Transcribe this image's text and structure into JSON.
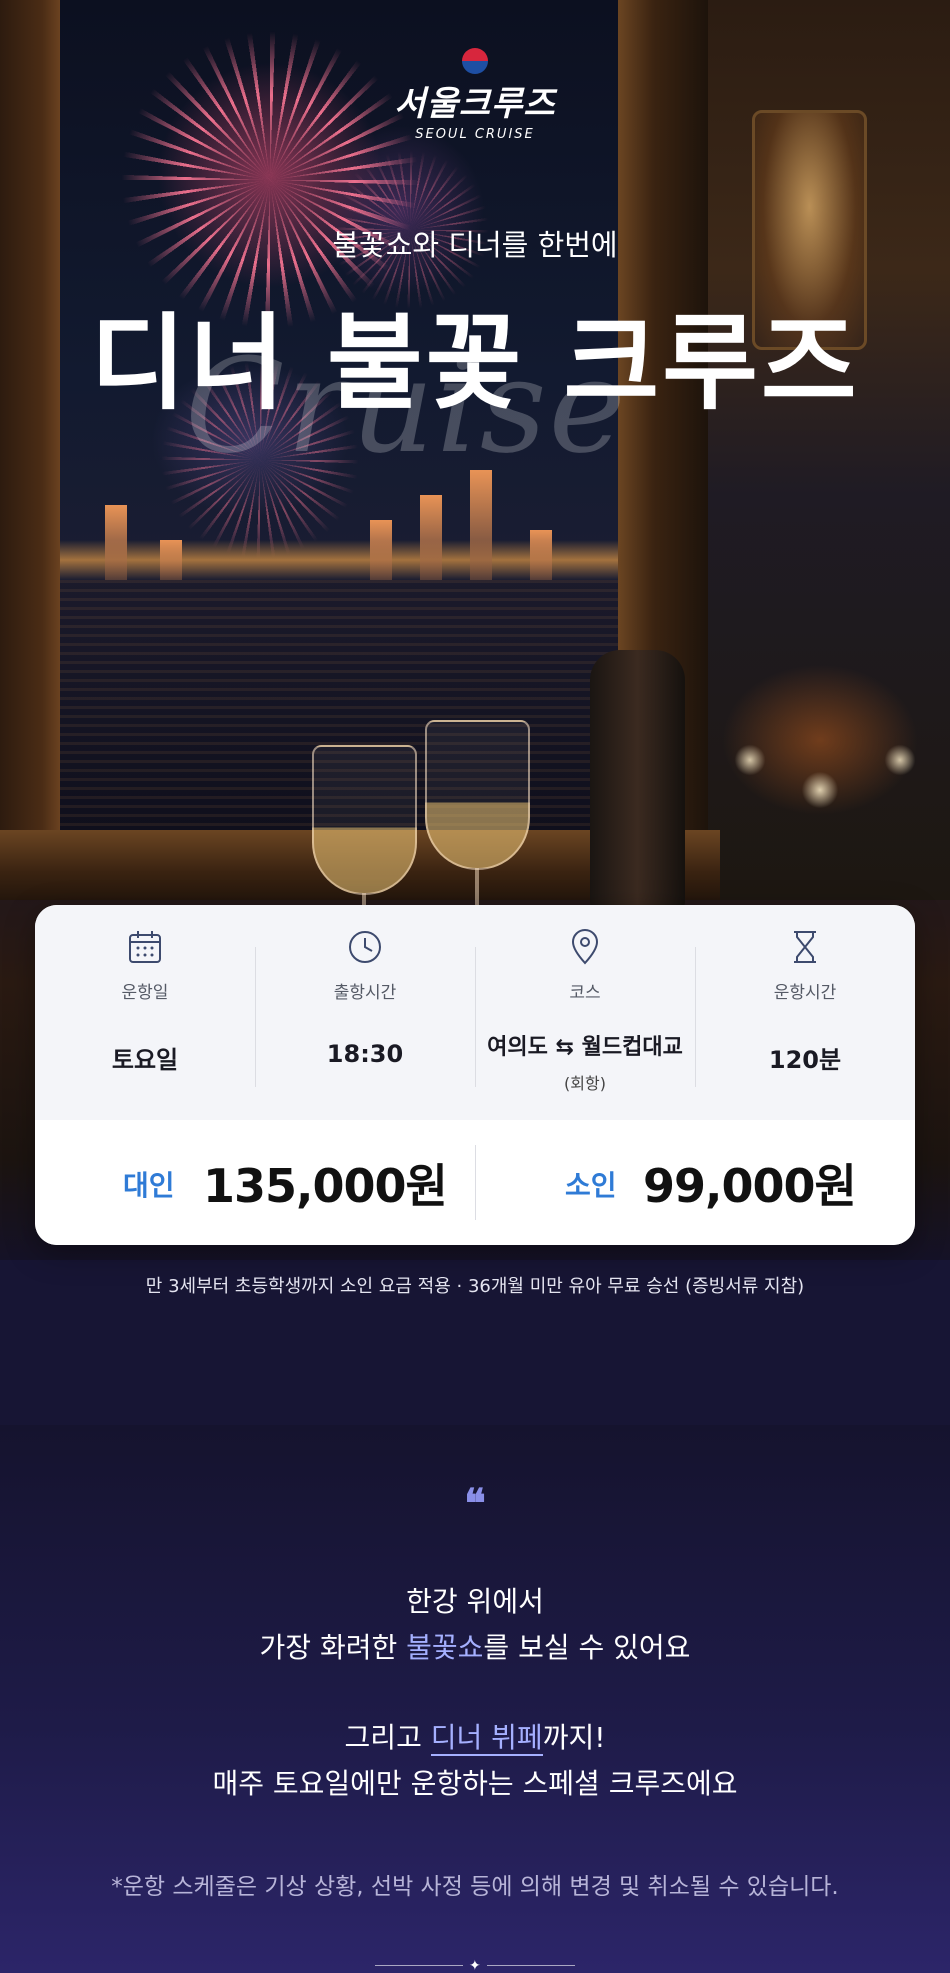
{
  "brand": {
    "name": "서울크루즈",
    "tagline": "SEOUL CRUISE"
  },
  "hero": {
    "subtitle": "불꽃쇼와 디너를 한번에",
    "title": "디너 불꽃 크루즈",
    "script_word": "Cruise"
  },
  "info": [
    {
      "icon": "calendar-icon",
      "label": "운항일",
      "value": "토요일",
      "sub": ""
    },
    {
      "icon": "clock-icon",
      "label": "출항시간",
      "value": "18:30",
      "sub": ""
    },
    {
      "icon": "location-pin-icon",
      "label": "코스",
      "value": "여의도 ⇆ 월드컵대교",
      "sub": "(회항)"
    },
    {
      "icon": "hourglass-icon",
      "label": "운항시간",
      "value": "120분",
      "sub": ""
    }
  ],
  "prices": {
    "adult": {
      "label": "대인",
      "value": "135,000원"
    },
    "child": {
      "label": "소인",
      "value": "99,000원"
    }
  },
  "note": "만 3세부터 초등학생까지 소인 요금 적용 · 36개월 미만 유아 무료 승선 (증빙서류 지참)",
  "quote": {
    "mark": "❝",
    "line1": "한강 위에서",
    "line2_pre": "가장 화려한 ",
    "line2_hl": "불꽃쇼",
    "line2_post": "를 보실 수 있어요",
    "line3_pre": "그리고 ",
    "line3_hl": "디너 뷔페",
    "line3_post": "까지!",
    "line4": "매주 토요일에만 운항하는 스페셜 크루즈에요"
  },
  "disclaimer": "*운항 스케줄은 기상 상황, 선박 사정 등에 의해 변경 및 취소될 수 있습니다.",
  "colors": {
    "accent_blue": "#2f7bd6",
    "highlight_violet": "#a5b0ff",
    "section_bg": "#1e1b48"
  }
}
